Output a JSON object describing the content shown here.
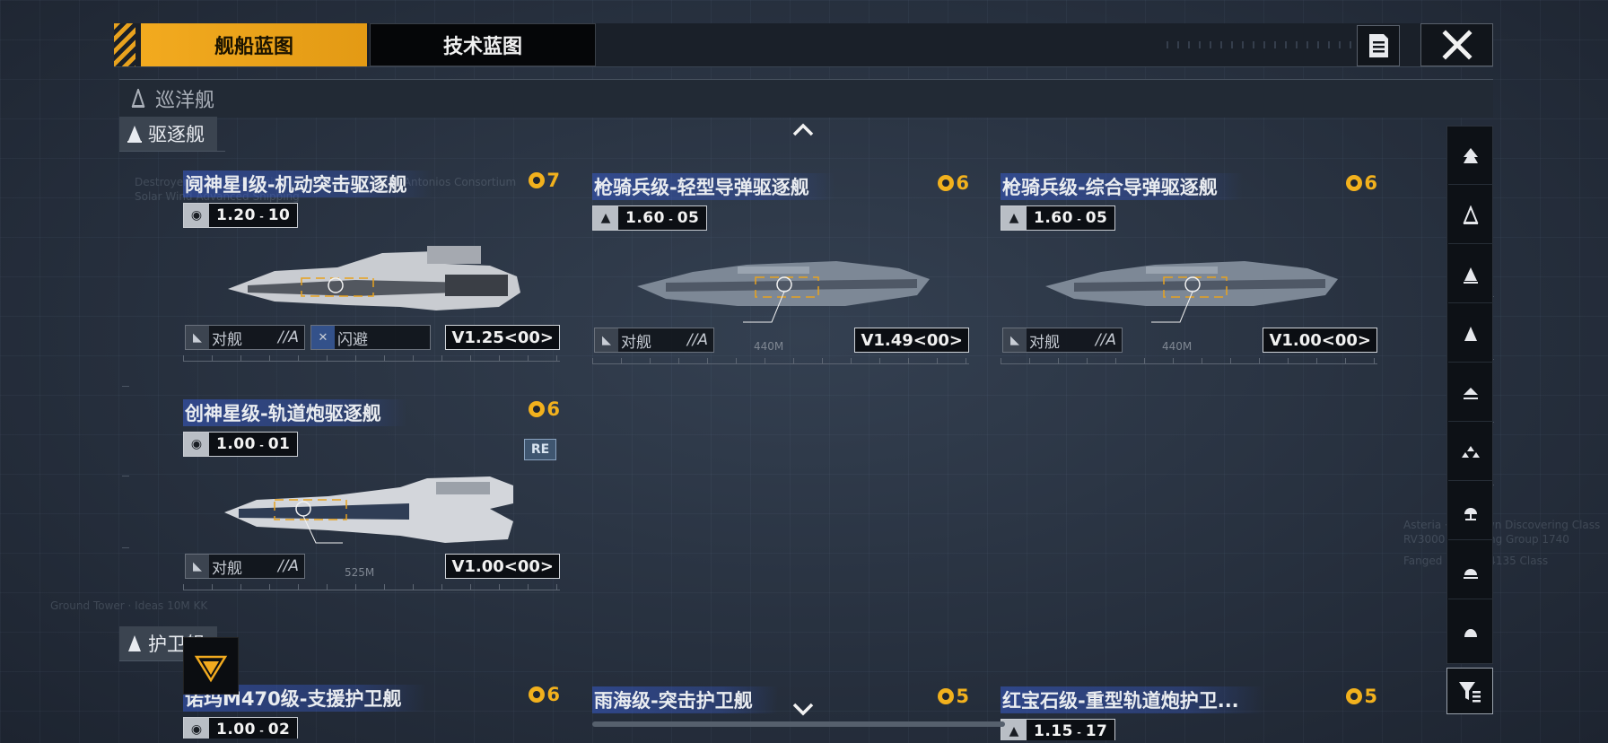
{
  "tabs": {
    "ship": "舰船蓝图",
    "tech": "技术蓝图"
  },
  "categories": {
    "cruiser": "巡洋舰",
    "destroyer": "驱逐舰",
    "frigate": "护卫舰"
  },
  "destroyers": [
    {
      "name": "阋神星I级-机动突击驱逐舰",
      "cost": "7",
      "spec": "1.20",
      "spec_sub": "10",
      "tag1": "对舰",
      "tag1_grade": "//A",
      "tag2": "闪避",
      "version": "V1.25<00>"
    },
    {
      "name": "枪骑兵级-轻型导弹驱逐舰",
      "cost": "6",
      "spec": "1.60",
      "spec_sub": "05",
      "tag1": "对舰",
      "tag1_grade": "//A",
      "dist": "440M",
      "version": "V1.49<00>"
    },
    {
      "name": "枪骑兵级-综合导弹驱逐舰",
      "cost": "6",
      "spec": "1.60",
      "spec_sub": "05",
      "tag1": "对舰",
      "tag1_grade": "//A",
      "dist": "440M",
      "version": "V1.00<00>"
    },
    {
      "name": "创神星级-轨道炮驱逐舰",
      "cost": "6",
      "spec": "1.00",
      "spec_sub": "01",
      "tag1": "对舰",
      "tag1_grade": "//A",
      "dist": "525M",
      "version": "V1.00<00>",
      "re": "RE"
    }
  ],
  "frigates": [
    {
      "name": "诺玛M470级-支援护卫舰",
      "cost": "6",
      "spec": "1.00",
      "spec_sub": "02"
    },
    {
      "name": "雨海级-突击护卫舰",
      "cost": "5"
    },
    {
      "name": "红宝石级-重型轨道炮护卫...",
      "cost": "5",
      "spec": "1.15",
      "spec_sub": "17"
    }
  ],
  "colors": {
    "accent": "#f2aa1f",
    "cost": "#f2b11d",
    "name_bar": "#375ac8",
    "bg": "#263040"
  },
  "sidebar_icons": [
    "carrier-icon",
    "cruiser-icon",
    "destroyer-icon",
    "frigate-icon",
    "corvette-icon",
    "fighter-icon",
    "support-icon",
    "auxiliary-icon",
    "other-icon",
    "filter-icon"
  ]
}
